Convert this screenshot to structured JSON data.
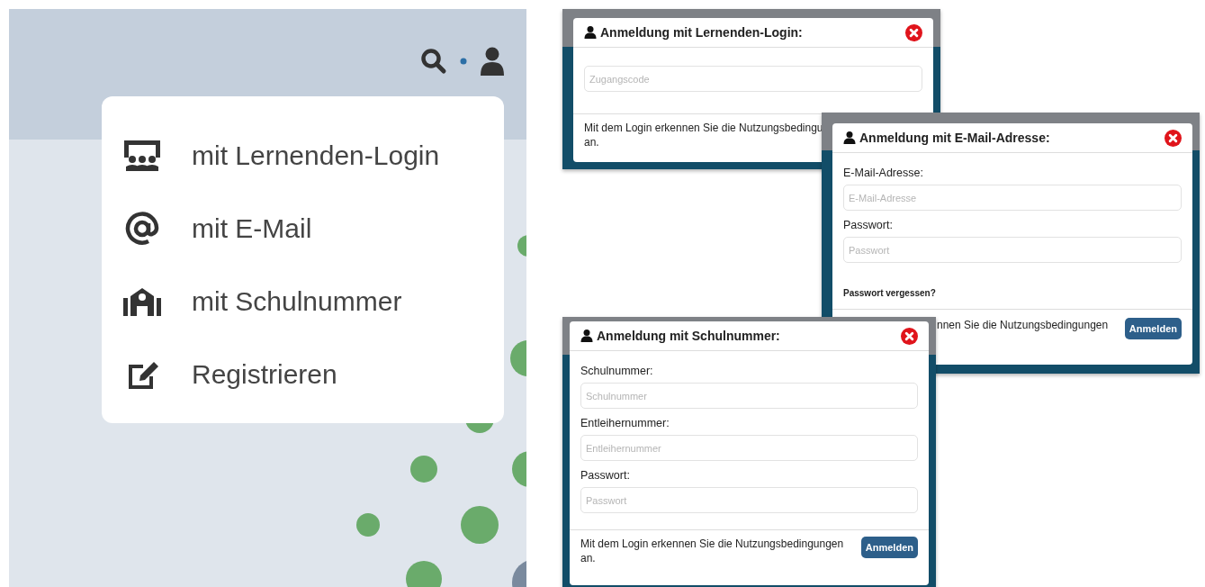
{
  "menu": {
    "items": [
      {
        "label": "mit Lernenden-Login",
        "kind": "classroom"
      },
      {
        "label": "mit E-Mail",
        "kind": "email"
      },
      {
        "label": "mit Schulnummer",
        "kind": "school"
      },
      {
        "label": "Registrieren",
        "kind": "register"
      }
    ]
  },
  "dialogs": [
    {
      "title": "Anmeldung mit Lernenden-Login:",
      "fields": [
        {
          "placeholder": "Zugangscode"
        }
      ],
      "footer_lines": [
        "Mit dem Login erkennen Sie die Nutzungsbedingu",
        "an."
      ]
    },
    {
      "title": "Anmeldung mit E-Mail-Adresse:",
      "fields": [
        {
          "label": "E-Mail-Adresse:",
          "placeholder": "E-Mail-Adresse"
        },
        {
          "label": "Passwort:",
          "placeholder": "Passwort"
        }
      ],
      "link": "Passwort vergessen?",
      "footer_lines": [
        "nnen Sie die Nutzungsbedingungen"
      ],
      "button": "Anmelden"
    },
    {
      "title": "Anmeldung mit Schulnummer:",
      "fields": [
        {
          "label": "Schulnummer:",
          "placeholder": "Schulnummer"
        },
        {
          "label": "Entleihernummer:",
          "placeholder": "Entleihernummer"
        },
        {
          "label": "Passwort:",
          "placeholder": "Passwort"
        }
      ],
      "footer_lines": [
        "Mit dem Login erkennen Sie die Nutzungsbedingungen",
        "an."
      ],
      "button": "Anmelden"
    }
  ]
}
